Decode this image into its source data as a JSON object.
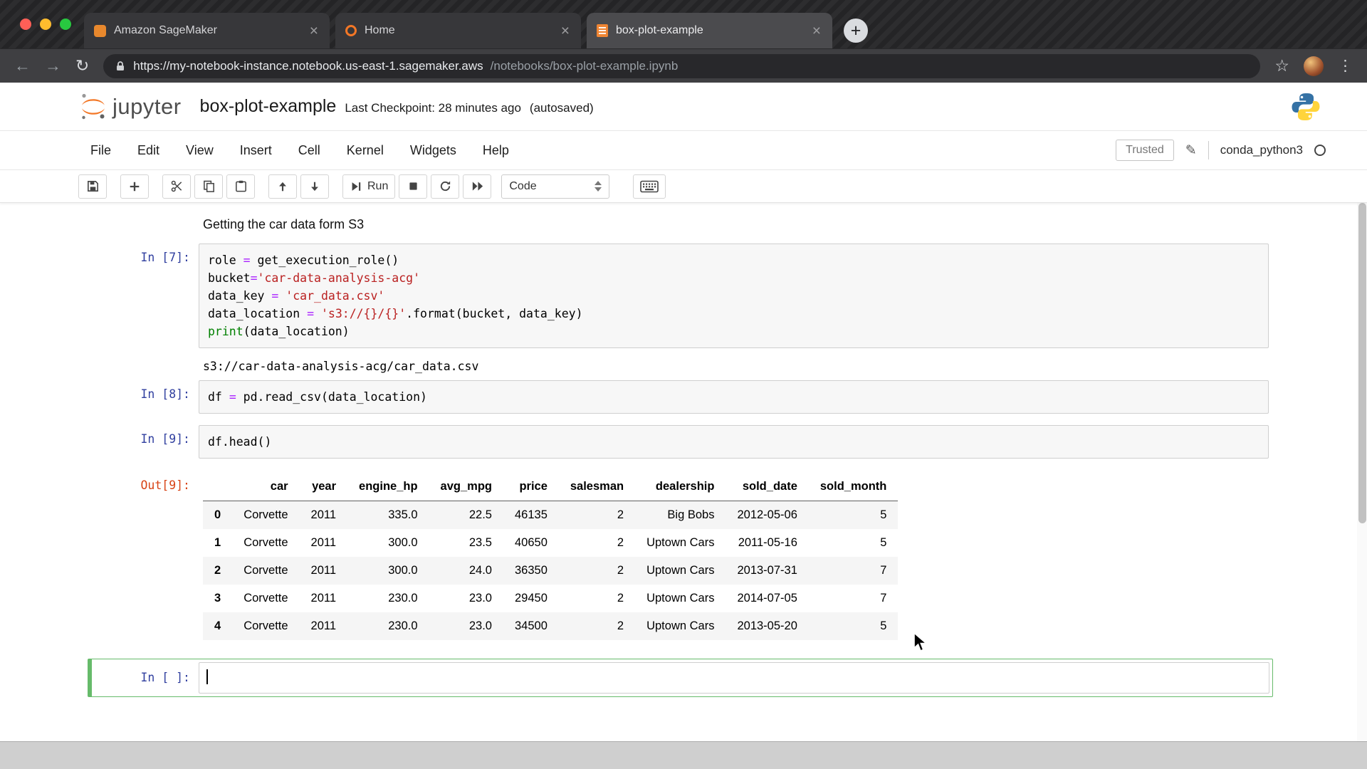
{
  "browser": {
    "tabs": [
      {
        "label": "Amazon SageMaker"
      },
      {
        "label": "Home"
      },
      {
        "label": "box-plot-example"
      }
    ],
    "url_domain": "https://my-notebook-instance.notebook.us-east-1.sagemaker.aws",
    "url_path": "/notebooks/box-plot-example.ipynb"
  },
  "icons": {
    "close_tab": "×",
    "new_tab": "+",
    "back": "←",
    "forward": "→",
    "reload": "↻",
    "star": "☆",
    "menu_dots": "⋮",
    "pencil": "✎"
  },
  "header": {
    "logo_text": "jupyter",
    "title": "box-plot-example",
    "checkpoint": "Last Checkpoint: 28 minutes ago",
    "autosaved": "(autosaved)"
  },
  "menubar": {
    "items": [
      "File",
      "Edit",
      "View",
      "Insert",
      "Cell",
      "Kernel",
      "Widgets",
      "Help"
    ],
    "trusted": "Trusted",
    "kernel": "conda_python3"
  },
  "toolbar": {
    "run_label": "Run",
    "cell_type": "Code"
  },
  "notebook": {
    "markdown": "Getting the car data form S3",
    "cells": [
      {
        "prompt": "In [7]:",
        "lines": [
          [
            {
              "c": "n",
              "t": "role "
            },
            {
              "c": "o",
              "t": "="
            },
            {
              "c": "n",
              "t": " get_execution_role()"
            }
          ],
          [
            {
              "c": "n",
              "t": "bucket"
            },
            {
              "c": "o",
              "t": "="
            },
            {
              "c": "s",
              "t": "'car-data-analysis-acg'"
            }
          ],
          [
            {
              "c": "n",
              "t": "data_key "
            },
            {
              "c": "o",
              "t": "="
            },
            {
              "c": "n",
              "t": " "
            },
            {
              "c": "s",
              "t": "'car_data.csv'"
            }
          ],
          [
            {
              "c": "n",
              "t": "data_location "
            },
            {
              "c": "o",
              "t": "="
            },
            {
              "c": "n",
              "t": " "
            },
            {
              "c": "s",
              "t": "'s3://{}/{}'"
            },
            {
              "c": "n",
              "t": ".format(bucket, data_key)"
            }
          ],
          [
            {
              "c": "k",
              "t": "print"
            },
            {
              "c": "n",
              "t": "(data_location)"
            }
          ]
        ]
      },
      {
        "prompt": "In [8]:",
        "lines": [
          [
            {
              "c": "n",
              "t": "df "
            },
            {
              "c": "o",
              "t": "="
            },
            {
              "c": "n",
              "t": " pd.read_csv(data_location)"
            }
          ]
        ]
      },
      {
        "prompt": "In [9]:",
        "lines": [
          [
            {
              "c": "n",
              "t": "df.head()"
            }
          ]
        ]
      }
    ],
    "stdout": "s3://car-data-analysis-acg/car_data.csv",
    "out_prompt": "Out[9]:",
    "empty_prompt": "In [ ]:",
    "table": {
      "columns": [
        "car",
        "year",
        "engine_hp",
        "avg_mpg",
        "price",
        "salesman",
        "dealership",
        "sold_date",
        "sold_month"
      ],
      "rows": [
        [
          "0",
          "Corvette",
          "2011",
          "335.0",
          "22.5",
          "46135",
          "2",
          "Big Bobs",
          "2012-05-06",
          "5"
        ],
        [
          "1",
          "Corvette",
          "2011",
          "300.0",
          "23.5",
          "40650",
          "2",
          "Uptown Cars",
          "2011-05-16",
          "5"
        ],
        [
          "2",
          "Corvette",
          "2011",
          "300.0",
          "24.0",
          "36350",
          "2",
          "Uptown Cars",
          "2013-07-31",
          "7"
        ],
        [
          "3",
          "Corvette",
          "2011",
          "230.0",
          "23.0",
          "29450",
          "2",
          "Uptown Cars",
          "2014-07-05",
          "7"
        ],
        [
          "4",
          "Corvette",
          "2011",
          "230.0",
          "23.0",
          "34500",
          "2",
          "Uptown Cars",
          "2013-05-20",
          "5"
        ]
      ]
    }
  },
  "colors": {
    "accent_orange": "#f37726",
    "prompt_in": "#303F9F",
    "prompt_out": "#D84315",
    "edit_mode_green": "#66BB6A",
    "string_red": "#BA2121",
    "operator_purple": "#AA22FF",
    "keyword_green": "#008000"
  }
}
